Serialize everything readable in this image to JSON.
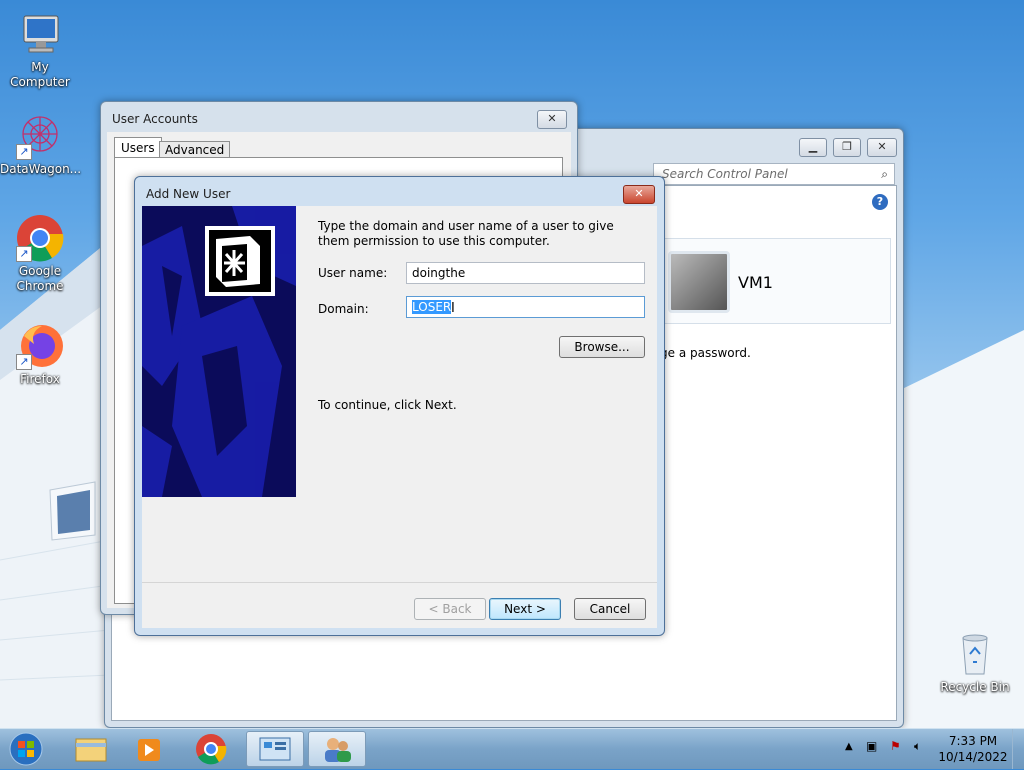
{
  "desktop": {
    "icons": [
      {
        "label": "My Computer",
        "icon": "computer-icon"
      },
      {
        "label": "DataWagon...",
        "icon": "datawagon-icon"
      },
      {
        "label": "Google Chrome",
        "icon": "chrome-icon"
      },
      {
        "label": "Firefox",
        "icon": "firefox-icon"
      },
      {
        "label": "Recycle Bin",
        "icon": "recycle-bin-icon"
      }
    ]
  },
  "control_panel": {
    "search_placeholder": "Search Control Panel",
    "account_name": "VM1",
    "partial_text": "ge a password."
  },
  "user_accounts": {
    "title": "User Accounts",
    "tabs": [
      "Users",
      "Advanced"
    ],
    "active_tab": "Users"
  },
  "add_new_user": {
    "title": "Add New User",
    "instructions": "Type the domain and user name of a user to give them permission to use this computer.",
    "username_label": "User name:",
    "username_value": "doingthe",
    "domain_label": "Domain:",
    "domain_value": "LOSER",
    "browse_label": "Browse...",
    "continue_text": "To continue, click Next.",
    "back_label": "< Back",
    "next_label": "Next >",
    "cancel_label": "Cancel"
  },
  "taskbar": {
    "items": [
      "start-orb",
      "explorer",
      "media-player",
      "chrome",
      "control-panel",
      "user-accounts"
    ],
    "time": "7:33 PM",
    "date": "10/14/2022"
  },
  "colors": {
    "selection": "#3399ff",
    "wizard_panel": "#0b0b5a"
  }
}
